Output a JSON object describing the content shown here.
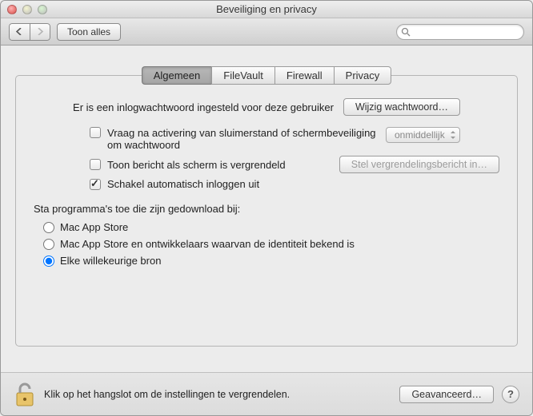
{
  "window": {
    "title": "Beveiliging en privacy"
  },
  "toolbar": {
    "show_all": "Toon alles",
    "search_placeholder": ""
  },
  "tabs": {
    "general": "Algemeen",
    "filevault": "FileVault",
    "firewall": "Firewall",
    "privacy": "Privacy"
  },
  "general": {
    "password_set_text": "Er is een inlogwachtwoord ingesteld voor deze gebruiker",
    "change_password_btn": "Wijzig wachtwoord…",
    "require_after_sleep": "Vraag na activering van sluimerstand of schermbeveiliging om wachtwoord",
    "delay_popup": "onmiddellijk",
    "show_message": "Toon bericht als scherm is vergrendeld",
    "set_lock_message_btn": "Stel vergrendelingsbericht in…",
    "disable_auto_login": "Schakel automatisch inloggen uit",
    "allow_apps_header": "Sta programma's toe die zijn gedownload bij:",
    "radio_appstore": "Mac App Store",
    "radio_appstore_dev": "Mac App Store en ontwikkelaars waarvan de identiteit bekend is",
    "radio_anywhere": "Elke willekeurige bron"
  },
  "footer": {
    "lock_text": "Klik op het hangslot om de instellingen te vergrendelen.",
    "advanced_btn": "Geavanceerd…",
    "help": "?"
  }
}
